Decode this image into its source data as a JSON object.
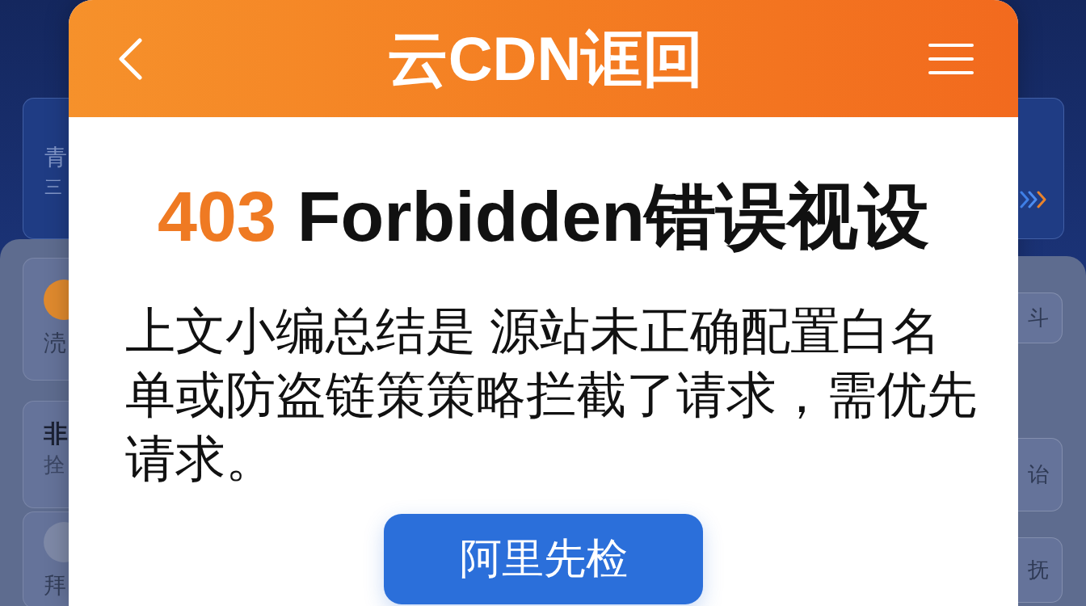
{
  "backdrop": {
    "left": {
      "banner_lines": [
        "青",
        "三"
      ],
      "cards": [
        {
          "kind": "circle-label",
          "color": "#e08a2e",
          "label": "涜"
        },
        {
          "kind": "title-sub",
          "title": "非",
          "subtitle": "拴"
        },
        {
          "kind": "circle-label",
          "color": "#7e89a7",
          "label": "拜"
        }
      ]
    },
    "right": {
      "chips": [
        "斗",
        "诒",
        "抚"
      ]
    }
  },
  "dialog": {
    "title": "云CDN诓回",
    "heading": {
      "code": "403",
      "text": "Forbidden错误视设"
    },
    "message": "上文小编总结是 源站未正确配置白名单或防盗链策策略拦截了请求，需优先请求。",
    "button": "阿里先检"
  }
}
